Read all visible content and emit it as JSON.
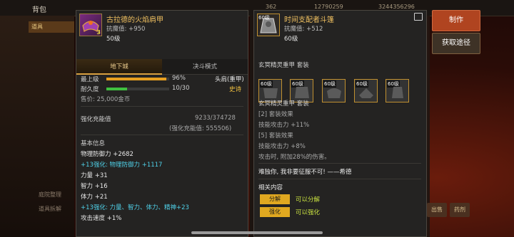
{
  "background": {
    "header_back": "背包",
    "resources": [
      "362",
      "12790259",
      "3244356296"
    ],
    "tab_active": "道具",
    "side_labels": [
      "庭院整理",
      "道具拆解"
    ],
    "bottom_buttons": [
      "出售",
      "药剂"
    ]
  },
  "left_item": {
    "name": "古拉德的火焰肩甲",
    "magic_resist": "抗魔值: +950",
    "level": "50级",
    "badge": "3",
    "tabs": [
      "地下城",
      "决斗模式"
    ],
    "min_level_label": "最上级",
    "min_level_value": "96%",
    "durability_label": "耐久度",
    "durability_value": "10/30",
    "slot": "头肩(重甲)",
    "rarity": "史诗",
    "price": "售价: 25,000金币",
    "reinforce_label": "强化充能值",
    "reinforce_value": "9233/374728",
    "reinforce_sub": "(强化充能值: 555506)",
    "basic_info_title": "基本信息",
    "stats": [
      {
        "text": "物理防御力 +2682",
        "color": "white"
      },
      {
        "text": "+13强化: 物理防御力 +1117",
        "color": "cyan"
      },
      {
        "text": "力量 +31",
        "color": "white"
      },
      {
        "text": "智力 +16",
        "color": "white"
      },
      {
        "text": "体力 +21",
        "color": "white"
      },
      {
        "text": "+13强化: 力量、智力、体力、精神+23",
        "color": "cyan"
      },
      {
        "text": "攻击速度 +1%",
        "color": "white"
      }
    ],
    "bar_fill_fraction": 0.96,
    "durability_fill_fraction": 0.33
  },
  "right_item": {
    "name": "时间支配者斗篷",
    "magic_resist": "抗魔值: +512",
    "level": "60级",
    "icon_tag": "60级",
    "set_name": "玄冥精灵重甲 套装",
    "pieces": [
      "60级",
      "60级",
      "60级",
      "60级",
      "60级"
    ],
    "set_name_2": "玄冥精灵重甲 套装",
    "set_effect_2": "[2] 套装效果",
    "set_effect_2_value": "技能攻击力 +11%",
    "set_effect_5": "[5] 套装效果",
    "set_effect_5_value": "技能攻击力 +8%",
    "set_effect_5_extra": "攻击时, 附加28%的伤害。",
    "quote": "难独你, 我非要征服不可! ——希德",
    "related_title": "相关内容",
    "related": [
      {
        "label": "分解",
        "value": "可以分解"
      },
      {
        "label": "强化",
        "value": "可以强化"
      }
    ]
  },
  "actions": {
    "make": "制作",
    "source": "获取途径"
  }
}
